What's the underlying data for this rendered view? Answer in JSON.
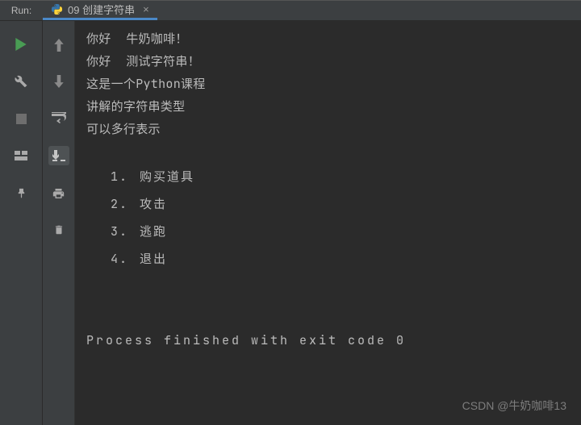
{
  "topbar": {
    "run_label": "Run:",
    "tab_label": "09 创建字符串"
  },
  "console": {
    "lines": [
      "你好  牛奶咖啡！",
      "你好  测试字符串！",
      "这是一个Python课程",
      "讲解的字符串类型",
      "可以多行表示"
    ],
    "menu": [
      {
        "num": "1.",
        "text": "购买道具"
      },
      {
        "num": "2.",
        "text": "攻击"
      },
      {
        "num": "3.",
        "text": "逃跑"
      },
      {
        "num": "4.",
        "text": "退出"
      }
    ],
    "exit_line": "Process finished with exit code 0"
  },
  "watermark": "CSDN @牛奶咖啡13"
}
